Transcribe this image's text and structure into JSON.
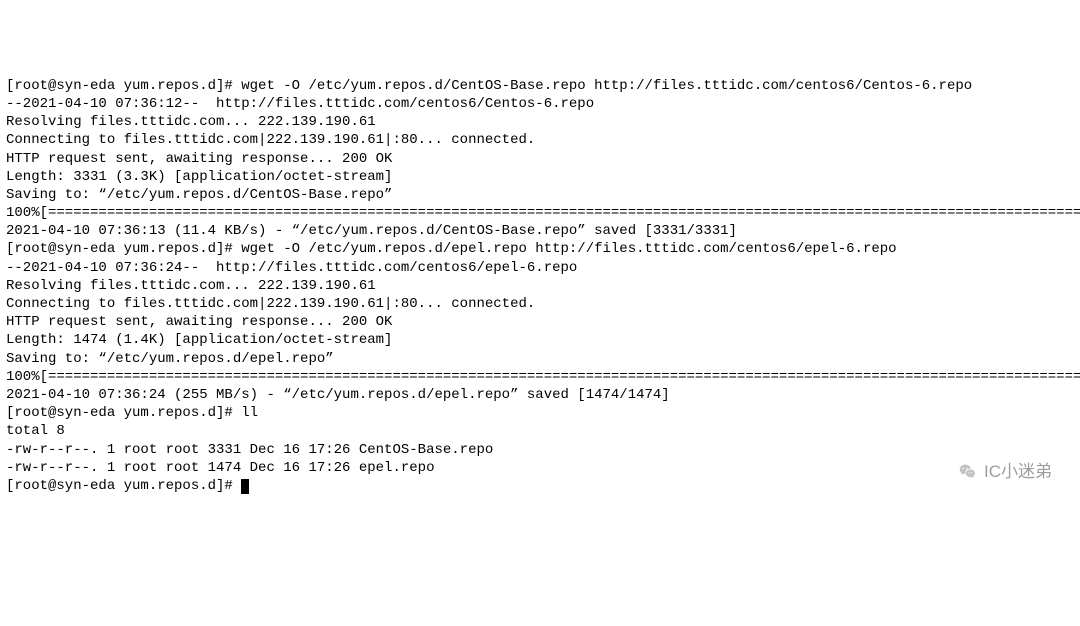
{
  "terminal": {
    "lines": [
      "[root@syn-eda yum.repos.d]# wget -O /etc/yum.repos.d/CentOS-Base.repo http://files.tttidc.com/centos6/Centos-6.repo",
      "--2021-04-10 07:36:12--  http://files.tttidc.com/centos6/Centos-6.repo",
      "Resolving files.tttidc.com... 222.139.190.61",
      "Connecting to files.tttidc.com|222.139.190.61|:80... connected.",
      "HTTP request sent, awaiting response... 200 OK",
      "Length: 3331 (3.3K) [application/octet-stream]",
      "Saving to: “/etc/yum.repos.d/CentOS-Base.repo”",
      "",
      "100%[========================================================================================================================================",
      "",
      "2021-04-10 07:36:13 (11.4 KB/s) - “/etc/yum.repos.d/CentOS-Base.repo” saved [3331/3331]",
      "",
      "[root@syn-eda yum.repos.d]# wget -O /etc/yum.repos.d/epel.repo http://files.tttidc.com/centos6/epel-6.repo",
      "--2021-04-10 07:36:24--  http://files.tttidc.com/centos6/epel-6.repo",
      "Resolving files.tttidc.com... 222.139.190.61",
      "Connecting to files.tttidc.com|222.139.190.61|:80... connected.",
      "HTTP request sent, awaiting response... 200 OK",
      "Length: 1474 (1.4K) [application/octet-stream]",
      "Saving to: “/etc/yum.repos.d/epel.repo”",
      "",
      "100%[========================================================================================================================================",
      "",
      "2021-04-10 07:36:24 (255 MB/s) - “/etc/yum.repos.d/epel.repo” saved [1474/1474]",
      "",
      "[root@syn-eda yum.repos.d]# ll",
      "total 8",
      "-rw-r--r--. 1 root root 3331 Dec 16 17:26 CentOS-Base.repo",
      "-rw-r--r--. 1 root root 1474 Dec 16 17:26 epel.repo",
      "[root@syn-eda yum.repos.d]# "
    ]
  },
  "watermark": {
    "text": "IC小迷弟"
  }
}
